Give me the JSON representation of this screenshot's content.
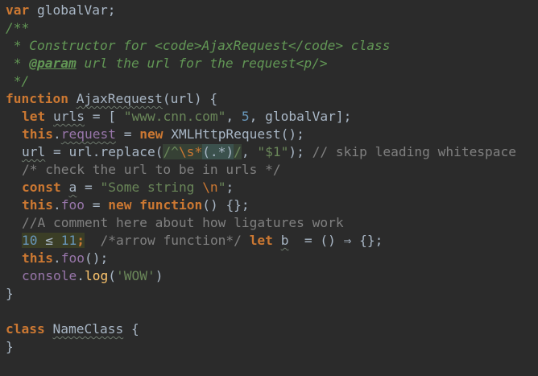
{
  "editor": {
    "theme_colors": {
      "background": "#2b2b2b",
      "keyword": "#cc7832",
      "string": "#6a8759",
      "number": "#6897bb",
      "comment": "#808080",
      "doc_comment": "#629755",
      "property": "#9876aa",
      "default_text": "#a9b7c6"
    },
    "lines": {
      "l1": {
        "kw": "var",
        "rest": " globalVar;"
      },
      "l2": {
        "text": "/**"
      },
      "l3": {
        "text": " * Constructor for <code>AjaxRequest</code> class"
      },
      "l4": {
        "pre": " * ",
        "tag": "@param",
        "post": " url the url for the request<p/>"
      },
      "l5": {
        "text": " */"
      },
      "l6": {
        "kw": "function",
        "sp": " ",
        "name": "AjaxRequest",
        "rest": "(url) {"
      },
      "l7": {
        "kw": "let",
        "sp": " ",
        "var": "urls",
        "mid": " = [ ",
        "s1": "\"www.cnn.com\"",
        "c1": ", ",
        "n1": "5",
        "c2": ", globalVar];"
      },
      "l8": {
        "kw": "this",
        "dot": ".",
        "prop": "request",
        "eq": " = ",
        "kw2": "new",
        "rest": " XMLHttpRequest();"
      },
      "l9": {
        "v": "url",
        "mid": " = url.replace(",
        "rx1": "/^",
        "rx2": "\\s*",
        "rx3": "(.*)",
        "rx4": "/",
        "c": ", ",
        "s": "\"$1\"",
        "end": ");",
        "cmt": " // skip leading whitespace"
      },
      "l10": {
        "text": "/* check the url to be in urls */"
      },
      "l11": {
        "kw": "const",
        "sp": " ",
        "var": "a",
        "eq": " = ",
        "s": "\"Some string ",
        "esc": "\\n",
        "s2": "\"",
        "end": ";"
      },
      "l12": {
        "kw": "this",
        "dot": ".",
        "prop": "foo",
        "eq": " = ",
        "kw2": "new",
        "sp": " ",
        "kw3": "function",
        "rest": "() {};"
      },
      "l13": {
        "text": "//A comment here about how ligatures work"
      },
      "l14": {
        "n1": "10",
        "op": " ≤ ",
        "n2": "11",
        "semi": ";",
        "gap": "  ",
        "cmt": "/*arrow function*/",
        "sp": " ",
        "kw": "let",
        "sp2": " ",
        "var": "b",
        "rest": "  = () ⇒ {};"
      },
      "l15": {
        "kw": "this",
        "dot": ".",
        "fn": "foo",
        "rest": "();"
      },
      "l16": {
        "obj": "console",
        "dot": ".",
        "fn": "log",
        "open": "(",
        "s": "'WOW'",
        "close": ")"
      },
      "l17": {
        "text": "}"
      },
      "l18": {
        "text": ""
      },
      "l19": {
        "kw": "class",
        "sp": " ",
        "name": "NameClass",
        "rest": " {"
      },
      "l20": {
        "text": "}"
      }
    }
  }
}
